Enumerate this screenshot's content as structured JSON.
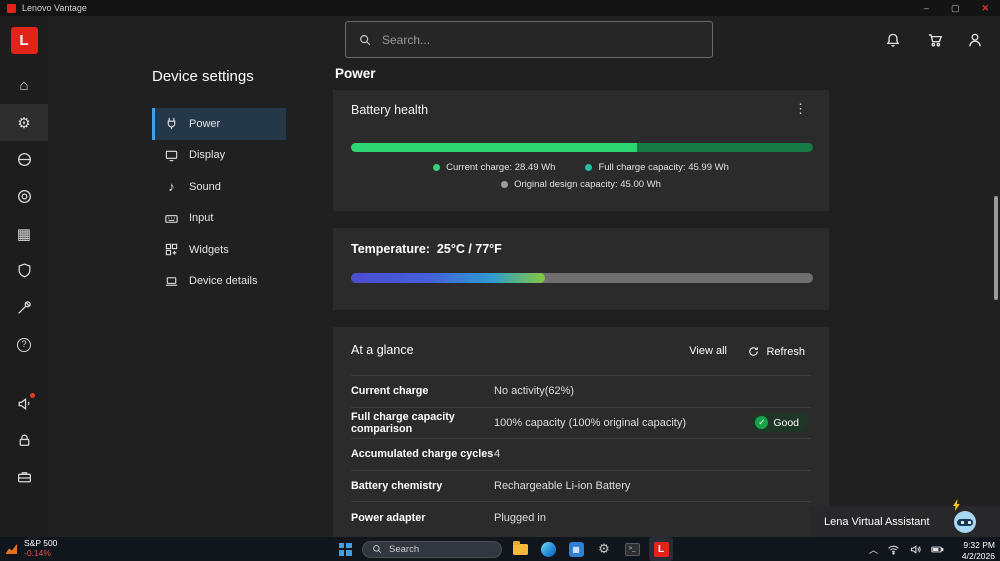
{
  "titlebar": {
    "app_name": "Lenovo Vantage"
  },
  "sidebar": {
    "logo_letter": "L",
    "icon_names": [
      "home-icon",
      "settings-gear-icon",
      "system-circle-icon",
      "target-icon",
      "apps-grid-icon",
      "shield-icon",
      "tools-icon",
      "help-icon",
      "whats-new-icon",
      "lock-icon",
      "device-case-icon"
    ]
  },
  "device_settings": {
    "title": "Device settings",
    "items": [
      {
        "label": "Power",
        "selected": true
      },
      {
        "label": "Display"
      },
      {
        "label": "Sound"
      },
      {
        "label": "Input"
      },
      {
        "label": "Widgets"
      },
      {
        "label": "Device details"
      }
    ]
  },
  "search": {
    "placeholder": "Search..."
  },
  "page": {
    "title": "Power"
  },
  "battery_card": {
    "title": "Battery health",
    "bar": {
      "current_pct": "62%",
      "bright_color": "#2ed573",
      "dim_color": "#157a46"
    },
    "legend": [
      {
        "text": "Current charge:  28.49 Wh",
        "color": "#2ed573"
      },
      {
        "text": "Full charge capacity:  45.99 Wh",
        "color": "#1fc2a0"
      },
      {
        "text": "Original design capacity:  45.00 Wh",
        "color": "#9e9e9e"
      }
    ]
  },
  "temperature_card": {
    "label": "Temperature:",
    "value": "25°C / 77°F",
    "fill_pct": "42%"
  },
  "glance_card": {
    "title": "At a glance",
    "view_all_label": "View all",
    "refresh_label": "Refresh",
    "rows": [
      {
        "label": "Current charge",
        "value": "No activity(62%)"
      },
      {
        "label": "Full charge capacity comparison",
        "value": "100% capacity (100% original capacity)",
        "badge": "Good"
      },
      {
        "label": "Accumulated charge cycles",
        "value": "4"
      },
      {
        "label": "Battery chemistry",
        "value": "Rechargeable Li-ion Battery"
      },
      {
        "label": "Power adapter",
        "value": "Plugged in"
      }
    ]
  },
  "assistant": {
    "label": "Lena Virtual Assistant"
  },
  "taskbar": {
    "stock": {
      "name": "S&P 500",
      "change": "-0.14%"
    },
    "search_label": "Search",
    "clock": {
      "time": "9:32 PM",
      "date": "4/2/2026"
    }
  }
}
